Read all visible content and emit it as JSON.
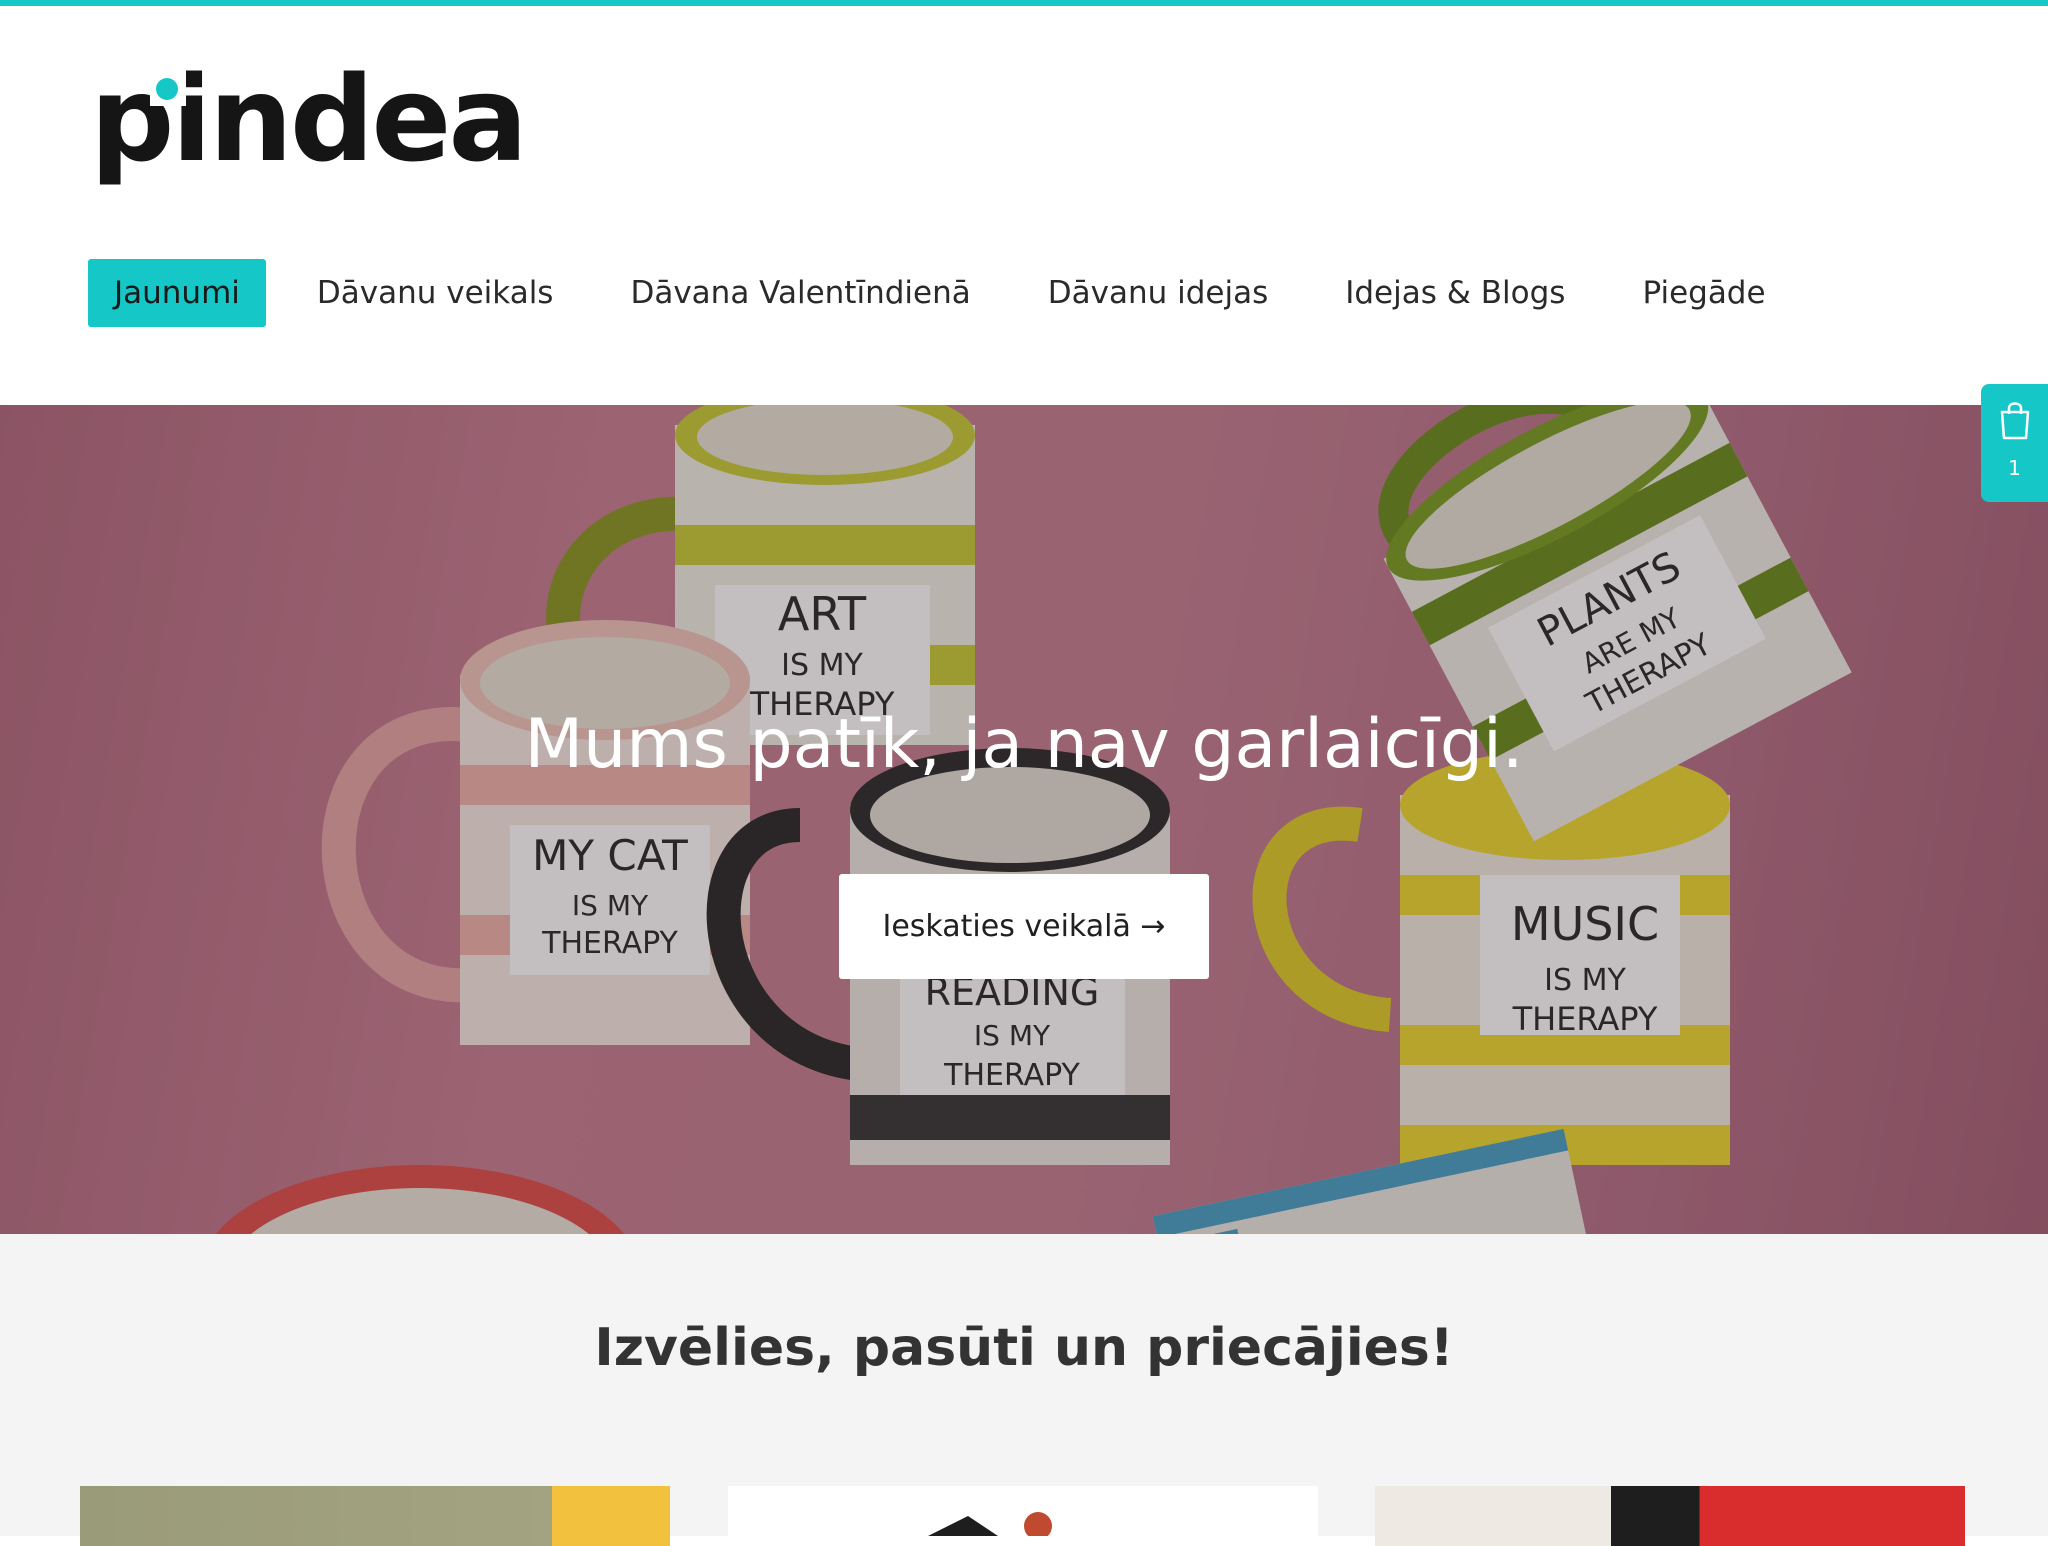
{
  "brand": {
    "logo_text": "pindea",
    "accent_color": "#16c7c7"
  },
  "nav": {
    "items": [
      {
        "label": "Jaunumi",
        "active": true
      },
      {
        "label": "Dāvanu veikals",
        "active": false
      },
      {
        "label": "Dāvana Valentīndienā",
        "active": false
      },
      {
        "label": "Dāvanu idejas",
        "active": false
      },
      {
        "label": "Idejas & Blogs",
        "active": false
      },
      {
        "label": "Piegāde",
        "active": false
      }
    ]
  },
  "hero": {
    "title": "Mums patīk, ja nav garlaicīgi.",
    "cta_label": "Ieskaties veikalā →",
    "mugs": [
      {
        "line1": "ART",
        "line2": "IS MY",
        "line3": "THERAPY"
      },
      {
        "line1": "MY CAT",
        "line2": "IS MY",
        "line3": "THERAPY"
      },
      {
        "line1": "PLANTS",
        "line2": "ARE MY",
        "line3": "THERAPY"
      },
      {
        "line1": "MUSIC",
        "line2": "IS MY",
        "line3": "THERAPY"
      },
      {
        "line1": "READING",
        "line2": "IS MY",
        "line3": "THERAPY"
      }
    ]
  },
  "cart": {
    "icon": "shopping-bag-icon",
    "count": "1"
  },
  "section": {
    "title": "Izvēlies, pasūti un priecājies!"
  }
}
